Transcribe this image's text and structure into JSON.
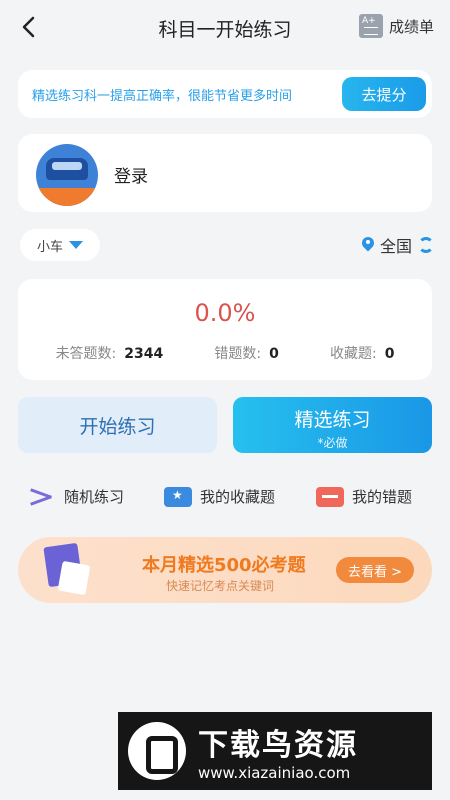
{
  "header": {
    "title": "科目一开始练习",
    "report_label": "成绩单"
  },
  "promo": {
    "text": "精选练习科一提高正确率，很能节省更多时间",
    "button": "去提分"
  },
  "user": {
    "login_label": "登录"
  },
  "filters": {
    "vehicle": "小车",
    "region": "全国"
  },
  "stats": {
    "accuracy": "0.0%",
    "unanswered_label": "未答题数:",
    "unanswered_value": "2344",
    "wrong_label": "错题数:",
    "wrong_value": "0",
    "favorites_label": "收藏题:",
    "favorites_value": "0"
  },
  "actions": {
    "start_label": "开始练习",
    "select_label": "精选练习",
    "select_sub": "*必做"
  },
  "quick_links": {
    "random": "随机练习",
    "favorites": "我的收藏题",
    "mistakes": "我的错题"
  },
  "banner": {
    "title": "本月精选500必考题",
    "subtitle": "快速记忆考点关键词",
    "button": "去看看 >"
  },
  "watermark": {
    "title": "下载鸟资源",
    "url": "www.xiazainiao.com"
  },
  "colors": {
    "accent": "#2a93e2",
    "percent": "#d9534f",
    "banner": "#f07a1e"
  }
}
